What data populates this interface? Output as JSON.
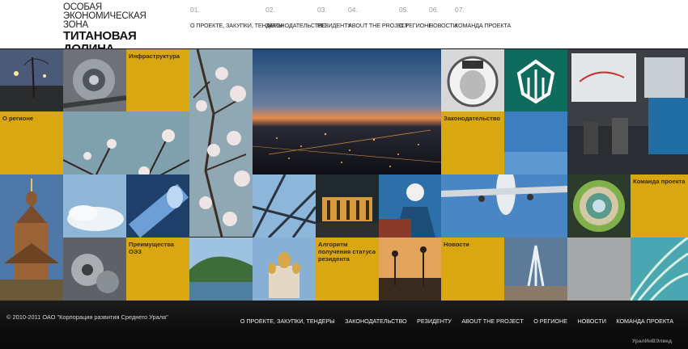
{
  "logo": {
    "line1": "ОСОБАЯ",
    "line2": "ЭКОНОМИЧЕСКАЯ",
    "line3": "ЗОНА",
    "name": "ТИТАНОВАЯ ДОЛИНА"
  },
  "nav": [
    {
      "num": "01.",
      "label": "О ПРОЕКТЕ, ЗАКУПКИ, ТЕНДЕРЫ"
    },
    {
      "num": "02.",
      "label": "ЗАКОНОДАТЕЛЬСТВО"
    },
    {
      "num": "03.",
      "label": "РЕЗИДЕНТУ"
    },
    {
      "num": "04.",
      "label": "ABOUT THE PROJECT"
    },
    {
      "num": "05.",
      "label": "О РЕГИОНЕ"
    },
    {
      "num": "06.",
      "label": "НОВОСТИ"
    },
    {
      "num": "07.",
      "label": "КОМАНДА ПРОЕКТА"
    }
  ],
  "tiles": {
    "infrastructure": "Инфраструктура",
    "region": "О регионе",
    "legislation": "Законодательство",
    "team": "Команда проекта",
    "advantages": "Преимущества ОЭЗ",
    "algorithm": "Алгоритм получения статуса резидента",
    "news": "Новости"
  },
  "footer": {
    "copyright": "© 2010-2011 ОАО \"Корпорация развития Среднего Урала\"",
    "links": [
      "О ПРОЕКТЕ, ЗАКУПКИ, ТЕНДЕРЫ",
      "ЗАКОНОДАТЕЛЬСТВО",
      "РЕЗИДЕНТУ",
      "ABOUT THE PROJECT",
      "О РЕГИОНЕ",
      "НОВОСТИ",
      "КОМАНДА ПРОЕКТА"
    ],
    "agency": "УралИнВЭлвед"
  },
  "colors": {
    "accent_yellow": "#d9a710",
    "header_bg": "#ffffff",
    "footer_bg": "#111111"
  }
}
